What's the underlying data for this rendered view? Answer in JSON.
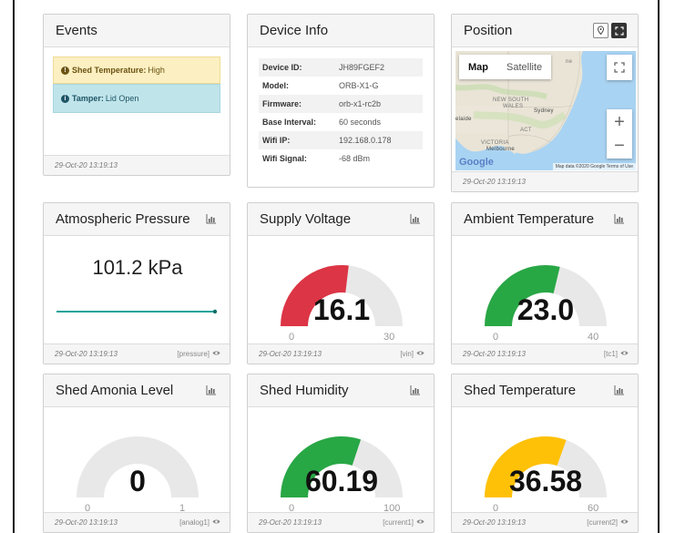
{
  "events": {
    "title": "Events",
    "alerts": [
      {
        "label": "Shed Temperature:",
        "value": "High",
        "level": "warning"
      },
      {
        "label": "Tamper:",
        "value": "Lid Open",
        "level": "info"
      }
    ],
    "timestamp": "29-Oct-20 13:19:13"
  },
  "device_info": {
    "title": "Device Info",
    "rows": [
      {
        "key": "Device ID:",
        "value": "JH89FGEF2"
      },
      {
        "key": "Model:",
        "value": "ORB-X1-G"
      },
      {
        "key": "Firmware:",
        "value": "orb-x1-rc2b"
      },
      {
        "key": "Base Interval:",
        "value": "60 seconds"
      },
      {
        "key": "Wifi IP:",
        "value": "192.168.0.178"
      },
      {
        "key": "Wifi Signal:",
        "value": "-68 dBm"
      }
    ]
  },
  "position": {
    "title": "Position",
    "map_tab_map": "Map",
    "map_tab_satellite": "Satellite",
    "labels": {
      "nsw": "NEW SOUTH",
      "wales": "WALES",
      "sydney": "Sydney",
      "act": "ACT",
      "victoria": "VICTORIA",
      "melbourne": "Melbourne",
      "adelaide": "elaide",
      "ne": "ne"
    },
    "google": "Google",
    "attribution": "Map data ©2020 Google   Terms of Use",
    "zoom_in": "+",
    "zoom_out": "−",
    "timestamp": "29-Oct-20 13:19:13"
  },
  "widgets": [
    {
      "title": "Atmospheric Pressure",
      "value": "101.2 kPa",
      "timestamp": "29-Oct-20 13:19:13",
      "tag": "[pressure]"
    },
    {
      "title": "Supply Voltage",
      "value": "16.1",
      "min": "0",
      "max": "30",
      "fraction": 0.537,
      "color": "#dc3545",
      "timestamp": "29-Oct-20 13:19:13",
      "tag": "[vin]"
    },
    {
      "title": "Ambient Temperature",
      "value": "23.0",
      "min": "0",
      "max": "40",
      "fraction": 0.575,
      "color": "#28a745",
      "timestamp": "29-Oct-20 13:19:13",
      "tag": "[tc1]"
    },
    {
      "title": "Shed Amonia Level",
      "value": "0",
      "min": "0",
      "max": "1",
      "fraction": 0.0,
      "color": "#28a745",
      "timestamp": "29-Oct-20 13:19:13",
      "tag": "[analog1]"
    },
    {
      "title": "Shed Humidity",
      "value": "60.19",
      "min": "0",
      "max": "100",
      "fraction": 0.6019,
      "color": "#28a745",
      "timestamp": "29-Oct-20 13:19:13",
      "tag": "[current1]"
    },
    {
      "title": "Shed Temperature",
      "value": "36.58",
      "min": "0",
      "max": "60",
      "fraction": 0.6097,
      "color": "#ffc107",
      "timestamp": "29-Oct-20 13:19:13",
      "tag": "[current2]"
    }
  ],
  "colors": {
    "gauge_track": "#e8e8e8",
    "sparkline": "#1aa39a"
  }
}
